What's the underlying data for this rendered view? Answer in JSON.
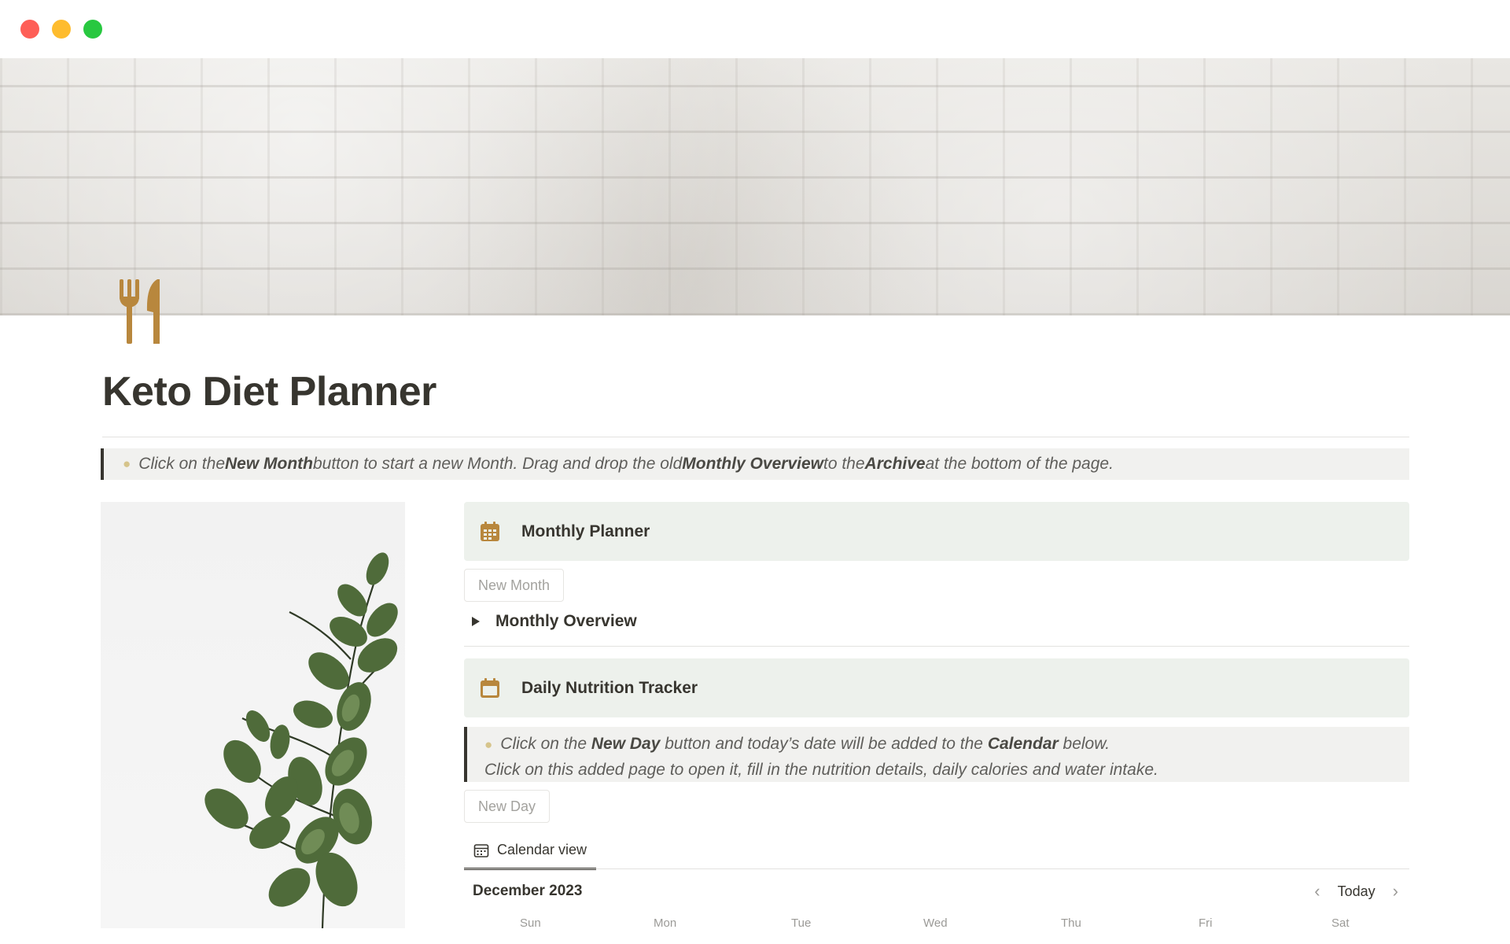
{
  "window": {
    "controls": [
      "close",
      "minimize",
      "maximize"
    ]
  },
  "page": {
    "icon": "fork-knife-icon",
    "title": "Keto Diet Planner",
    "accent_color": "#b8873d"
  },
  "top_callout": {
    "icon": "lightbulb-icon",
    "parts": [
      "Click on the ",
      "New Month",
      " button to start a new Month. Drag and drop the old ",
      "Monthly Overview",
      " to the ",
      "Archive",
      " at the bottom of the page."
    ]
  },
  "monthly_planner": {
    "icon": "calendar-grid-icon",
    "heading": "Monthly Planner",
    "button_label": "New Month",
    "toggle_label": "Monthly Overview"
  },
  "daily_tracker": {
    "icon": "calendar-icon",
    "heading": "Daily Nutrition Tracker",
    "callout": {
      "line1": [
        "Click on the ",
        "New Day",
        " button and today’s date will be added to the ",
        "Calendar",
        " below."
      ],
      "line2": "Click on this added page to open it, fill in the nutrition details, daily calories and water intake."
    },
    "button_label": "New Day"
  },
  "calendar": {
    "tab_icon": "calendar-view-icon",
    "tab_label": "Calendar view",
    "month": "December 2023",
    "today_label": "Today",
    "weekdays": [
      "Sun",
      "Mon",
      "Tue",
      "Wed",
      "Thu",
      "Fri",
      "Sat"
    ]
  },
  "side_image": {
    "subject": "eucalyptus branch"
  }
}
